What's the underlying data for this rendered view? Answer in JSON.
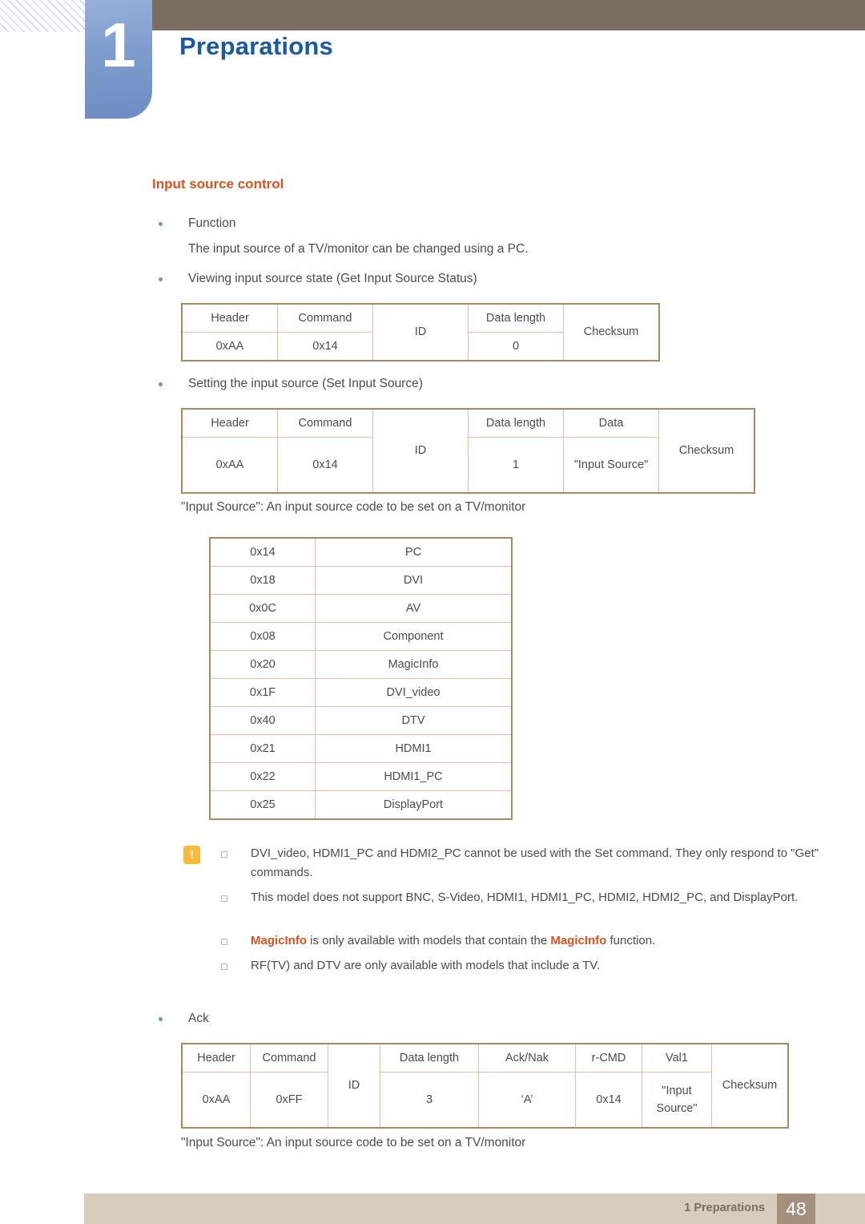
{
  "chapter": {
    "number": "1",
    "title": "Preparations"
  },
  "section": {
    "heading": "Input source control"
  },
  "bullets": {
    "function_label": "Function",
    "function_desc": "The input source of a TV/monitor can be changed using a PC.",
    "get_label": "Viewing input source state (Get Input Source Status)",
    "set_label": "Setting the input source (Set Input Source)",
    "ack_label": "Ack"
  },
  "notes_caption": {
    "set_note": "\"Input Source\": An input source code to be set on a TV/monitor",
    "ack_note": "\"Input Source\": An input source code to be set on a TV/monitor"
  },
  "get_table": {
    "headers": [
      "Header",
      "Command",
      "ID",
      "Data length",
      "Checksum"
    ],
    "values": [
      "0xAA",
      "0x14",
      "",
      "0",
      ""
    ]
  },
  "set_table": {
    "headers": [
      "Header",
      "Command",
      "ID",
      "Data length",
      "Data",
      "Checksum"
    ],
    "values": [
      "0xAA",
      "0x14",
      "",
      "1",
      "\"Input Source\"",
      ""
    ]
  },
  "ack_table": {
    "headers": [
      "Header",
      "Command",
      "ID",
      "Data length",
      "Ack/Nak",
      "r-CMD",
      "Val1",
      "Checksum"
    ],
    "values": [
      "0xAA",
      "0xFF",
      "",
      "3",
      "‘A’",
      "0x14",
      "\"Input Source\"",
      ""
    ]
  },
  "source_codes": {
    "rows": [
      {
        "code": "0x14",
        "name": "PC"
      },
      {
        "code": "0x18",
        "name": "DVI"
      },
      {
        "code": "0x0C",
        "name": "AV"
      },
      {
        "code": "0x08",
        "name": "Component"
      },
      {
        "code": "0x20",
        "name": "MagicInfo"
      },
      {
        "code": "0x1F",
        "name": "DVI_video"
      },
      {
        "code": "0x40",
        "name": "DTV"
      },
      {
        "code": "0x21",
        "name": "HDMI1"
      },
      {
        "code": "0x22",
        "name": "HDMI1_PC"
      },
      {
        "code": "0x25",
        "name": "DisplayPort"
      }
    ]
  },
  "notes": {
    "icon": "warning-icon",
    "items": [
      {
        "text": "DVI_video, HDMI1_PC and HDMI2_PC cannot be used with the Set command. They only respond to \"Get\" commands.",
        "html": "DVI_video, HDMI1_PC and HDMI2_PC cannot be used with the Set command. They only respond to \"Get\" commands."
      },
      {
        "text": "This model does not support BNC, S-Video, HDMI1, HDMI1_PC, HDMI2, HDMI2_PC, and DisplayPort.",
        "html": "This model does not support BNC, S-Video, HDMI1, HDMI1_PC, HDMI2, HDMI2_PC, and DisplayPort."
      },
      {
        "text": "MagicInfo is only available with models that contain the MagicInfo function.",
        "html": "<span class=\"mi\">MagicInfo</span> is only available with models that contain the <span class=\"mi\">MagicInfo</span> function."
      },
      {
        "text": "RF(TV) and DTV are only available with models that include a TV.",
        "html": "RF(TV) and DTV are only available with models that include a TV."
      }
    ]
  },
  "footer": {
    "label": "1 Preparations",
    "page": "48"
  },
  "colors": {
    "accent_orange": "#d5551e",
    "chapter_blue": "#1a5a9e",
    "tab_blue": "#7e9bcd",
    "header_brown": "#7b6d60",
    "footer_tan": "#d8cdbc",
    "page_box": "#a3907f",
    "table_border": "#a98a5e",
    "table_inner": "#eab9a6",
    "warning_yellow": "#f9b93c"
  }
}
